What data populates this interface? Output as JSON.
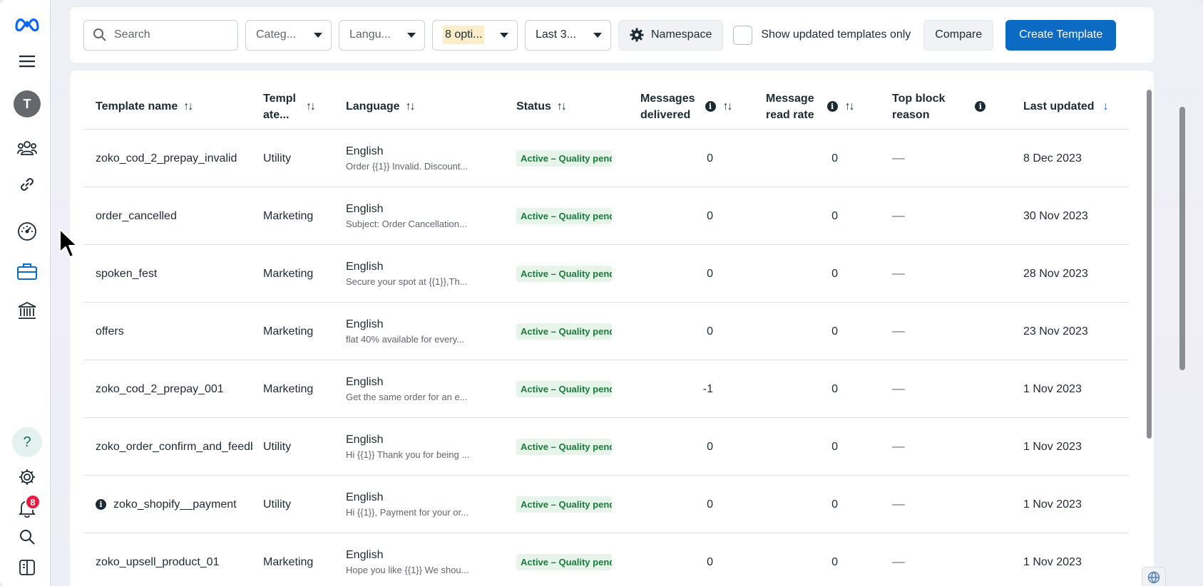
{
  "sidebar": {
    "icons": [
      "meta-logo-icon",
      "menu-icon",
      "avatar",
      "people-icon",
      "link-icon",
      "dashboard-icon",
      "briefcase-icon",
      "bank-icon",
      "help-icon",
      "gear-icon",
      "bell-icon",
      "search-icon",
      "panel-toggle-icon"
    ],
    "avatar_initial": "T",
    "help_label": "?",
    "notification_count": "8",
    "accent_color": "#0b6ac2"
  },
  "toolbar": {
    "search_placeholder": "Search",
    "category_label": "Categ...",
    "language_label": "Langu...",
    "options_label": "8 opti...",
    "date_label": "Last 3...",
    "namespace_label": "Namespace",
    "show_updated_label": "Show updated templates only",
    "compare_label": "Compare",
    "create_label": "Create Template"
  },
  "table": {
    "headers": {
      "name": "Template name",
      "category_line1": "Templ",
      "category_line2": "ate...",
      "language": "Language",
      "status": "Status",
      "delivered_line1": "Messages",
      "delivered_line2": "delivered",
      "read_line1": "Message",
      "read_line2": "read rate",
      "block_line1": "Top block",
      "block_line2": "reason",
      "updated": "Last updated"
    },
    "rows": [
      {
        "name": "zoko_cod_2_prepay_invalid",
        "category": "Utility",
        "language": "English",
        "preview": "Order {{1}} Invalid. Discount...",
        "status": "Active – Quality pending",
        "delivered": "0",
        "read_rate": "0",
        "block_reason": "––",
        "updated": "8 Dec 2023",
        "info": false
      },
      {
        "name": "order_cancelled",
        "category": "Marketing",
        "language": "English",
        "preview": "Subject: Order Cancellation...",
        "status": "Active – Quality pending",
        "delivered": "0",
        "read_rate": "0",
        "block_reason": "––",
        "updated": "30 Nov 2023",
        "info": false
      },
      {
        "name": "spoken_fest",
        "category": "Marketing",
        "language": "English",
        "preview": "Secure your spot at {{1}},Th...",
        "status": "Active – Quality pending",
        "delivered": "0",
        "read_rate": "0",
        "block_reason": "––",
        "updated": "28 Nov 2023",
        "info": false
      },
      {
        "name": "offers",
        "category": "Marketing",
        "language": "English",
        "preview": "flat 40% available for every...",
        "status": "Active – Quality pending",
        "delivered": "0",
        "read_rate": "0",
        "block_reason": "––",
        "updated": "23 Nov 2023",
        "info": false
      },
      {
        "name": "zoko_cod_2_prepay_001",
        "category": "Marketing",
        "language": "English",
        "preview": "Get the same order for an e...",
        "status": "Active – Quality pending",
        "delivered": "-1",
        "read_rate": "0",
        "block_reason": "––",
        "updated": "1 Nov 2023",
        "info": false
      },
      {
        "name": "zoko_order_confirm_and_feedback",
        "category": "Utility",
        "language": "English",
        "preview": "Hi {{1}} Thank you for being ...",
        "status": "Active – Quality pending",
        "delivered": "0",
        "read_rate": "0",
        "block_reason": "––",
        "updated": "1 Nov 2023",
        "info": false
      },
      {
        "name": "zoko_shopify__payment",
        "category": "Utility",
        "language": "English",
        "preview": "Hi {{1}}, Payment for your or...",
        "status": "Active – Quality pending",
        "delivered": "0",
        "read_rate": "0",
        "block_reason": "––",
        "updated": "1 Nov 2023",
        "info": true
      },
      {
        "name": "zoko_upsell_product_01",
        "category": "Marketing",
        "language": "English",
        "preview": "Hope you like {{1}} We shou...",
        "status": "Active – Quality pending",
        "delivered": "0",
        "read_rate": "0",
        "block_reason": "––",
        "updated": "1 Nov 2023",
        "info": false
      }
    ]
  }
}
